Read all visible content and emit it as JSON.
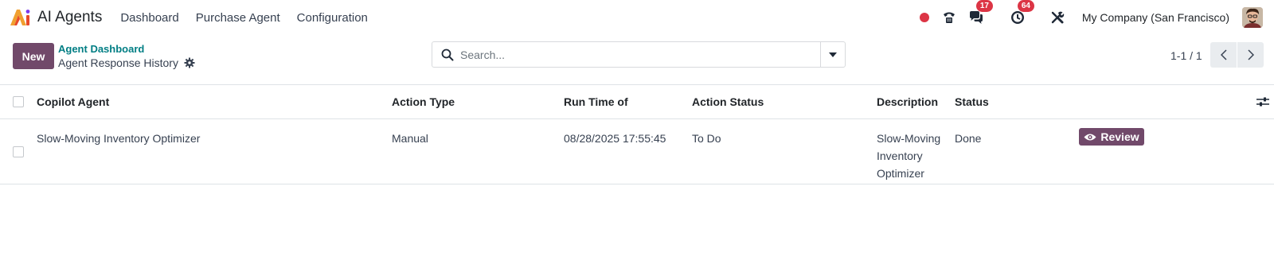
{
  "app": {
    "name": "AI Agents",
    "logo_label": "Ai"
  },
  "nav": {
    "menu": [
      "Dashboard",
      "Purchase Agent",
      "Configuration"
    ],
    "messages_count": "17",
    "activities_count": "64",
    "company": "My Company (San Francisco)"
  },
  "control": {
    "new_label": "New",
    "breadcrumb_parent": "Agent Dashboard",
    "breadcrumb_current": "Agent Response History",
    "search_placeholder": "Search...",
    "pager_value": "1-1 / 1"
  },
  "table": {
    "columns": [
      "Copilot Agent",
      "Action Type",
      "Run Time of",
      "Action Status",
      "Description",
      "Status"
    ],
    "rows": [
      {
        "agent": "Slow-Moving Inventory Optimizer",
        "action_type": "Manual",
        "run_time": "08/28/2025 17:55:45",
        "action_status": "To Do",
        "description": "Slow-Moving Inventory Optimizer",
        "status": "Done",
        "button": "Review"
      }
    ]
  },
  "colors": {
    "primary": "#71496a",
    "link": "#017e84",
    "danger": "#dc3545"
  },
  "icons": [
    "ai-logo-icon",
    "phone-icon",
    "messages-icon",
    "clock-icon",
    "tools-icon",
    "gear-icon",
    "search-icon",
    "caret-down-icon",
    "chevron-left-icon",
    "chevron-right-icon",
    "sliders-icon",
    "eye-icon"
  ]
}
